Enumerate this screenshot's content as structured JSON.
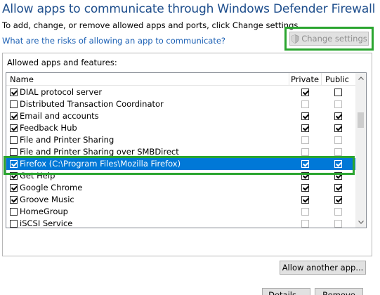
{
  "header": {
    "title": "Allow apps to communicate through Windows Defender Firewall",
    "subtitle": "To add, change, or remove allowed apps and ports, click Change settings.",
    "risk_link": "What are the risks of allowing an app to communicate?",
    "change_settings_label": "Change settings"
  },
  "group": {
    "label": "Allowed apps and features:",
    "columns": {
      "name": "Name",
      "private": "Private",
      "public": "Public"
    },
    "apps": [
      {
        "name": "DIAL protocol server",
        "enabled": true,
        "private": true,
        "public": false
      },
      {
        "name": "Distributed Transaction Coordinator",
        "enabled": false,
        "private": false,
        "public": false
      },
      {
        "name": "Email and accounts",
        "enabled": true,
        "private": true,
        "public": true
      },
      {
        "name": "Feedback Hub",
        "enabled": true,
        "private": true,
        "public": true
      },
      {
        "name": "File and Printer Sharing",
        "enabled": false,
        "private": false,
        "public": false
      },
      {
        "name": "File and Printer Sharing over SMBDirect",
        "enabled": false,
        "private": false,
        "public": false
      },
      {
        "name": "Firefox (C:\\Program Files\\Mozilla Firefox)",
        "enabled": true,
        "private": true,
        "public": true,
        "selected": true
      },
      {
        "name": "Get Help",
        "enabled": true,
        "private": true,
        "public": true
      },
      {
        "name": "Google Chrome",
        "enabled": true,
        "private": true,
        "public": true
      },
      {
        "name": "Groove Music",
        "enabled": true,
        "private": true,
        "public": true
      },
      {
        "name": "HomeGroup",
        "enabled": false,
        "private": false,
        "public": false
      },
      {
        "name": "iSCSI Service",
        "enabled": false,
        "private": false,
        "public": false
      }
    ],
    "details_label": "Details...",
    "remove_label": "Remove"
  },
  "footer": {
    "allow_another_label": "Allow another app..."
  },
  "colors": {
    "title": "#1e4e8c",
    "link": "#1a5fb4",
    "selection": "#0078d7",
    "highlight_border": "#2aa52f"
  },
  "icons": {
    "shield": "shield-icon",
    "scroll_up": "chevron-up-icon",
    "scroll_down": "chevron-down-icon"
  }
}
